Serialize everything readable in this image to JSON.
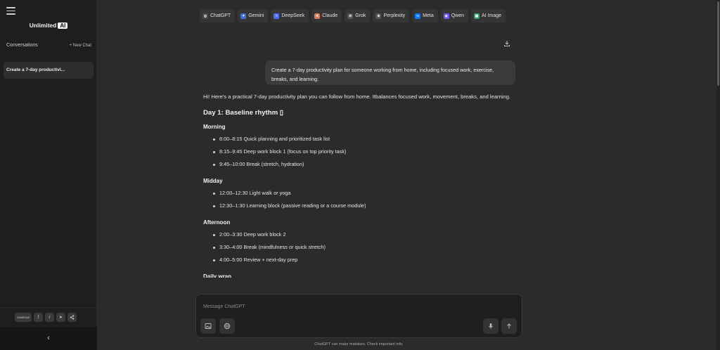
{
  "sidebar": {
    "brand_text": "Unlimited",
    "brand_badge": "AI",
    "conversations_label": "Conversations",
    "new_chat_label": "+ New Chat",
    "conversations": [
      "Create a 7-day productivi..."
    ],
    "social": [
      {
        "name": "gumroad",
        "label": "GUMROAD"
      },
      {
        "name": "facebook",
        "label": "f"
      },
      {
        "name": "reddit",
        "label": "r"
      },
      {
        "name": "telegram",
        "label": "➤"
      },
      {
        "name": "share",
        "label": "<"
      }
    ],
    "collapse_glyph": "‹"
  },
  "model_tabs": [
    {
      "label": "ChatGPT",
      "icon": "chatgpt-icon",
      "color": "#4a4a4a",
      "glyph": "◎"
    },
    {
      "label": "Gemini",
      "icon": "gemini-icon",
      "color": "#3b6fd1",
      "glyph": "✦"
    },
    {
      "label": "DeepSeek",
      "icon": "deepseek-icon",
      "color": "#4d6bfe",
      "glyph": "≈"
    },
    {
      "label": "Claude",
      "icon": "claude-icon",
      "color": "#d97757",
      "glyph": "✳"
    },
    {
      "label": "Grok",
      "icon": "grok-icon",
      "color": "#555555",
      "glyph": "⊘"
    },
    {
      "label": "Perplexity",
      "icon": "perplexity-icon",
      "color": "#555555",
      "glyph": "※"
    },
    {
      "label": "Meta",
      "icon": "meta-icon",
      "color": "#0a7cff",
      "glyph": "∞"
    },
    {
      "label": "Qwen",
      "icon": "qwen-icon",
      "color": "#6b5bff",
      "glyph": "◈"
    },
    {
      "label": "AI Image",
      "icon": "ai-image-icon",
      "color": "#2fa36b",
      "glyph": "▣"
    }
  ],
  "chat": {
    "user_message": "Create a 7-day productivity plan for someone working from home, including focused work, exercise, breaks, and learning.",
    "intro": "Hi! Here's a practical 7-day productivity plan you can follow from home. Itbalances focused work, movement, breaks, and learning.",
    "day_title": "Day 1: Baseline rhythm ▯",
    "sections": [
      {
        "title": "Morning",
        "items": [
          "8:00–8:15 Quick planning and prioritized task list",
          "8:15–9:45 Deep work block 1 (focus on top priority task)",
          "9:45–10:00 Break (stretch, hydration)"
        ]
      },
      {
        "title": "Midday",
        "items": [
          "12:00–12:30 Light walk or yoga",
          "12:30–1:30 Learning block (passive reading or a course module)"
        ]
      },
      {
        "title": "Afternoon",
        "items": [
          "2:00–3:30 Deep work block 2",
          "3:30–4:00 Break (mindfulness or quick stretch)",
          "4:00–5:00 Review + next-day prep"
        ]
      }
    ],
    "cut_off_heading": "Daily wrap"
  },
  "composer": {
    "placeholder": "Message ChatGPT",
    "disclaimer": "ChatGPT can make mistakes. Check important info."
  }
}
